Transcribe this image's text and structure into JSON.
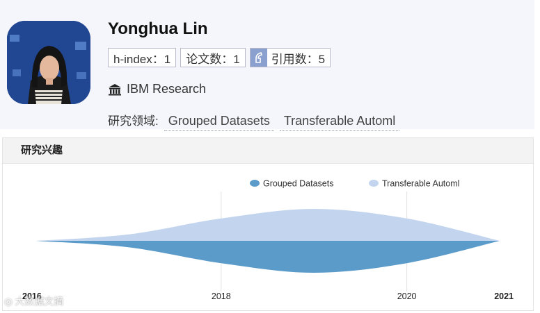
{
  "profile": {
    "name": "Yonghua Lin",
    "h_index_label": "h-index：1",
    "papers_label": "论文数：1",
    "citations_label": "引用数：5",
    "affiliation": "IBM Research",
    "fields_label": "研究领域:",
    "fields": [
      "Grouped Datasets",
      "Transferable Automl"
    ]
  },
  "panel": {
    "title": "研究兴趣"
  },
  "watermark": "大数据文摘",
  "colors": {
    "series1": "#5b9bc9",
    "series2": "#c3d5ee",
    "cite_icon_bg": "#8aa0cf",
    "header_bg": "#f5f6fb"
  },
  "icons": {
    "institution": "bank-building-icon",
    "citation": "quote-icon"
  },
  "chart_data": {
    "type": "area",
    "title": "",
    "legend": "top-right",
    "series": [
      {
        "name": "Grouped Datasets",
        "color": "#5b9bc9",
        "x": [
          2016,
          2017,
          2018,
          2019,
          2020,
          2021
        ],
        "values": [
          0,
          0.2,
          0.7,
          1.0,
          0.7,
          0
        ]
      },
      {
        "name": "Transferable Automl",
        "color": "#c3d5ee",
        "x": [
          2016,
          2017,
          2018,
          2019,
          2020,
          2021
        ],
        "values": [
          0,
          0.2,
          0.7,
          1.0,
          0.7,
          0
        ]
      }
    ],
    "xlim": [
      2016,
      2021
    ],
    "x_ticks": [
      {
        "value": 2016,
        "label": "2016",
        "bold": true
      },
      {
        "value": 2018,
        "label": "2018",
        "bold": false
      },
      {
        "value": 2020,
        "label": "2020",
        "bold": false
      },
      {
        "value": 2021,
        "label": "2021",
        "bold": true
      }
    ],
    "gridlines_at": [
      2018,
      2020
    ]
  }
}
